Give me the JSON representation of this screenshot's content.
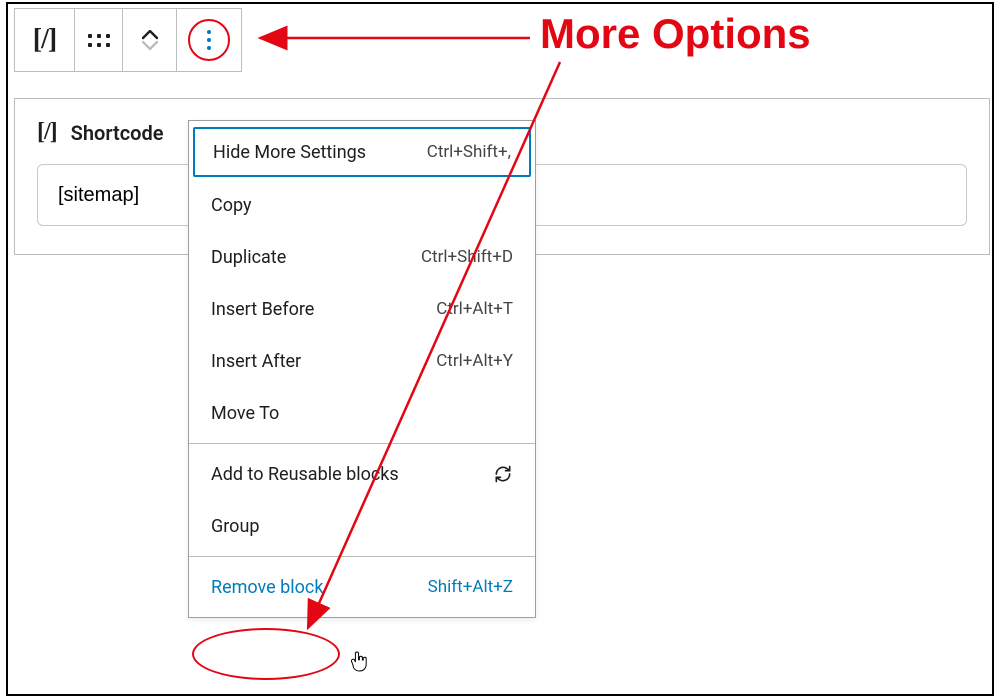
{
  "toolbar": {
    "type_icon": "[/]",
    "more_icon": "kebab"
  },
  "block": {
    "title": "Shortcode",
    "icon": "[/]",
    "value": "[sitemap]"
  },
  "menu": {
    "section1": [
      {
        "label": "Hide More Settings",
        "shortcut": "Ctrl+Shift+,",
        "highlight": true
      },
      {
        "label": "Copy",
        "shortcut": ""
      },
      {
        "label": "Duplicate",
        "shortcut": "Ctrl+Shift+D"
      },
      {
        "label": "Insert Before",
        "shortcut": "Ctrl+Alt+T"
      },
      {
        "label": "Insert After",
        "shortcut": "Ctrl+Alt+Y"
      },
      {
        "label": "Move To",
        "shortcut": ""
      }
    ],
    "section2": [
      {
        "label": "Add to Reusable blocks",
        "icon": "refresh"
      },
      {
        "label": "Group"
      }
    ],
    "section3": [
      {
        "label": "Remove block",
        "shortcut": "Shift+Alt+Z",
        "remove": true
      }
    ]
  },
  "annotation": {
    "label": "More Options"
  }
}
